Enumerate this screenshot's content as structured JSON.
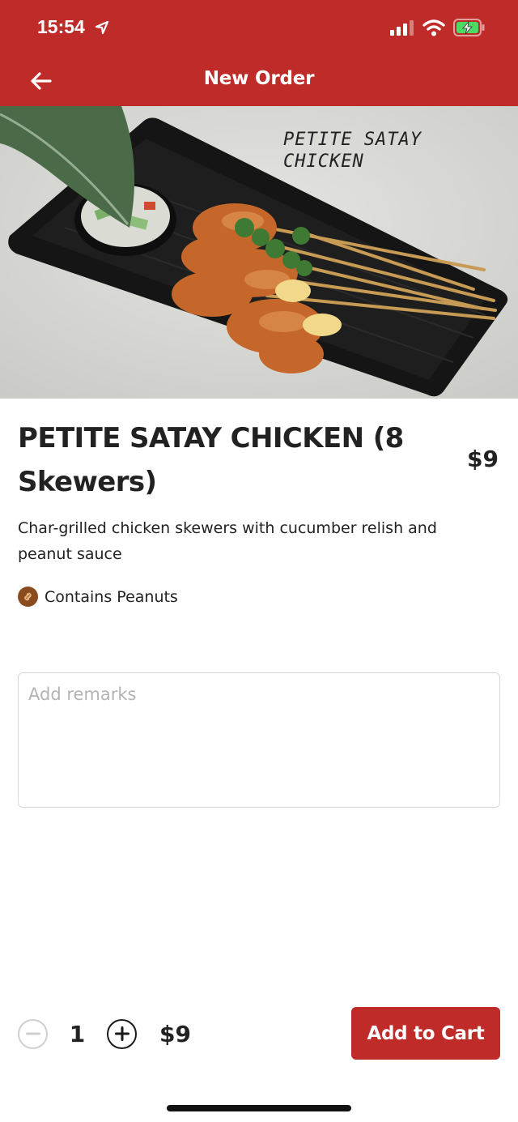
{
  "status_bar": {
    "time": "15:54"
  },
  "header": {
    "title": "New Order",
    "accent": "#bf2b28"
  },
  "hero": {
    "caption": "PETITE SATAY\nCHICKEN"
  },
  "item": {
    "name": "PETITE SATAY CHICKEN (8 Skewers)",
    "price": "$9",
    "description": "Char-grilled chicken skewers with cucumber relish and peanut sauce",
    "allergen": {
      "icon": "peanut-icon",
      "label": "Contains Peanuts"
    }
  },
  "remarks": {
    "placeholder": "Add remarks",
    "value": ""
  },
  "order": {
    "quantity": "1",
    "total": "$9",
    "add_to_cart_label": "Add to Cart"
  }
}
